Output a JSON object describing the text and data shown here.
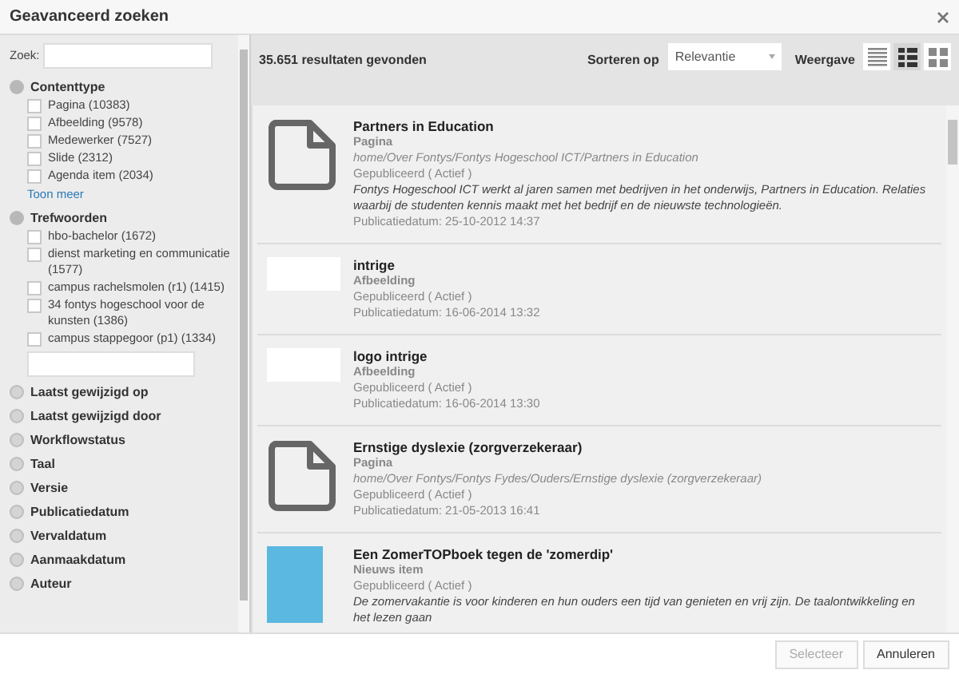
{
  "window": {
    "title": "Geavanceerd zoeken"
  },
  "search": {
    "label": "Zoek:"
  },
  "facets": [
    {
      "title": "Contenttype",
      "expanded": true,
      "options": [
        {
          "label": "Pagina (10383)",
          "checked": false
        },
        {
          "label": "Afbeelding (9578)",
          "checked": false
        },
        {
          "label": "Medewerker (7527)",
          "checked": false
        },
        {
          "label": "Slide (2312)",
          "checked": false
        },
        {
          "label": "Agenda item (2034)",
          "checked": false
        }
      ],
      "more_link": "Toon meer"
    },
    {
      "title": "Trefwoorden",
      "expanded": true,
      "options": [
        {
          "label": "hbo-bachelor (1672)",
          "checked": false
        },
        {
          "label": "dienst marketing en communicatie (1577)",
          "checked": false
        },
        {
          "label": "campus rachelsmolen (r1) (1415)",
          "checked": false
        },
        {
          "label": "34 fontys hogeschool voor de kunsten (1386)",
          "checked": false
        },
        {
          "label": "campus stappegoor (p1) (1334)",
          "checked": false
        }
      ],
      "filter_field": true
    },
    {
      "title": "Laatst gewijzigd op",
      "expanded": false
    },
    {
      "title": "Laatst gewijzigd door",
      "expanded": false
    },
    {
      "title": "Workflowstatus",
      "expanded": false
    },
    {
      "title": "Taal",
      "expanded": false
    },
    {
      "title": "Versie",
      "expanded": false
    },
    {
      "title": "Publicatiedatum",
      "expanded": false
    },
    {
      "title": "Vervaldatum",
      "expanded": false
    },
    {
      "title": "Aanmaakdatum",
      "expanded": false
    },
    {
      "title": "Auteur",
      "expanded": false
    }
  ],
  "results_header": {
    "count": "35.651 resultaten gevonden",
    "sort_label": "Sorteren op",
    "sort_value": "Relevantie",
    "view_label": "Weergave",
    "views": [
      {
        "kind": "list",
        "selected": false
      },
      {
        "kind": "detail",
        "selected": true
      },
      {
        "kind": "grid",
        "selected": false
      }
    ]
  },
  "results": [
    {
      "kind": "page",
      "title": "Partners in Education",
      "type": "Pagina",
      "path": "home/Over Fontys/Fontys Hogeschool ICT/Partners in Education",
      "status": "Gepubliceerd ( Actief )",
      "description": "Fontys Hogeschool ICT werkt al jaren samen met bedrijven in het onderwijs, Partners in Education. Relaties waarbij de studenten kennis maakt met het bedrijf en de nieuwste technologieën.",
      "date": "Publicatiedatum: 25-10-2012 14:37"
    },
    {
      "kind": "image",
      "title": "intrige",
      "type": "Afbeelding",
      "status": "Gepubliceerd ( Actief )",
      "date": "Publicatiedatum: 16-06-2014 13:32"
    },
    {
      "kind": "image",
      "title": "logo intrige",
      "type": "Afbeelding",
      "status": "Gepubliceerd ( Actief )",
      "date": "Publicatiedatum: 16-06-2014 13:30"
    },
    {
      "kind": "page",
      "title": "Ernstige dyslexie (zorgverzekeraar)",
      "type": "Pagina",
      "path": "home/Over Fontys/Fontys Fydes/Ouders/Ernstige dyslexie (zorgverzekeraar)",
      "status": "Gepubliceerd ( Actief )",
      "date": "Publicatiedatum: 21-05-2013 16:41"
    },
    {
      "kind": "photo",
      "title": "Een ZomerTOPboek tegen de 'zomerdip'",
      "type": "Nieuws item",
      "status": "Gepubliceerd ( Actief )",
      "description": "De zomervakantie is voor kinderen en hun ouders een tijd van genieten en vrij zijn. De taalontwikkeling en het lezen gaan"
    }
  ],
  "buttons": [
    {
      "label": "Selecteer",
      "disabled": true
    },
    {
      "label": "Annuleren",
      "disabled": false
    }
  ]
}
